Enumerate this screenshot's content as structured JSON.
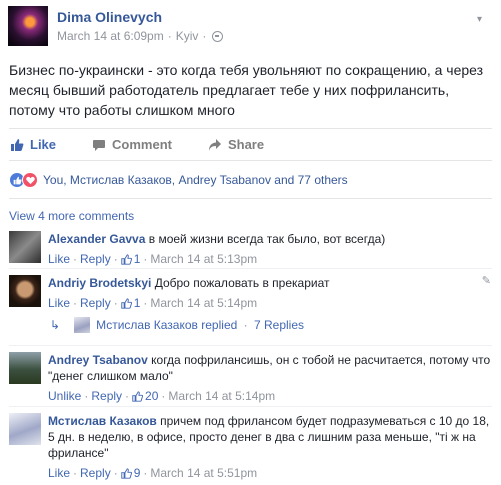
{
  "post": {
    "author": "Dima Olinevych",
    "date": "March 14 at 6:09pm",
    "dot": "·",
    "location": "Kyiv",
    "text": "Бизнес по-украински - это когда тебя увольняют по сокращению, а через месяц бывший работодатель предлагает тебе у них пофрилансить, потому что работы слишком много"
  },
  "actions": {
    "like": "Like",
    "comment": "Comment",
    "share": "Share"
  },
  "reactions": {
    "names": "You, Мстислав Казаков, Andrey Tsabanov and 77 others"
  },
  "view_more": "View 4 more comments",
  "comments": [
    {
      "name": "Alexander Gavva",
      "text": "в моей жизни всегда так было, вот всегда)",
      "like": "Like",
      "reply": "Reply",
      "count": "1",
      "time": "March 14 at 5:13pm"
    },
    {
      "name": "Andriy Brodetskyi",
      "text": "Добро пожаловать в прекариат",
      "like": "Like",
      "reply": "Reply",
      "count": "1",
      "time": "March 14 at 5:14pm"
    },
    {
      "name": "Andrey Tsabanov",
      "text": "когда пофрилансишь, он с тобой не расчитается, потому что \"денег слишком мало\"",
      "like": "Unlike",
      "reply": "Reply",
      "count": "20",
      "time": "March 14 at 5:14pm"
    },
    {
      "name": "Мстислав Казаков",
      "text": "причем под фрилансом будет подразумеваться с 10 до 18, 5 дн. в неделю, в офисе, просто денег в два с лишним раза меньше, \"ті ж на фрилансе\"",
      "like": "Like",
      "reply": "Reply",
      "count": "9",
      "time": "March 14 at 5:51pm"
    }
  ],
  "reply_summary": {
    "name": "Мстислав Казаков",
    "verb": "replied",
    "count": "7 Replies"
  },
  "sep": "·",
  "colors": {
    "link": "#365899",
    "accent": "#4267b2",
    "meta": "#90949c"
  }
}
